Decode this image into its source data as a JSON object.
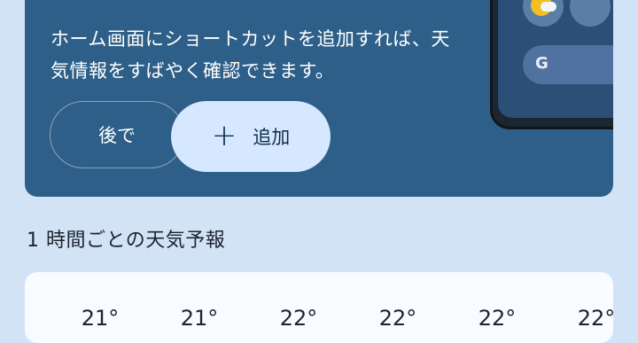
{
  "promo": {
    "message": "ホーム画面にショートカットを追加すれば、天気情報をすばやく確認できます。",
    "later_label": "後で",
    "add_label": "追加",
    "add_icon": "plus-icon",
    "preview": {
      "search_glyph": "G",
      "icons": [
        "weather-app-icon",
        "app-icon",
        "google-icon"
      ]
    }
  },
  "hourly": {
    "title": "1 時間ごとの天気予報",
    "temps": [
      "21°",
      "21°",
      "22°",
      "22°",
      "22°",
      "22°"
    ]
  },
  "colors": {
    "background": "#d3e3f6",
    "promo_bg": "#2e5f89",
    "add_button_bg": "#d6e8ff"
  }
}
